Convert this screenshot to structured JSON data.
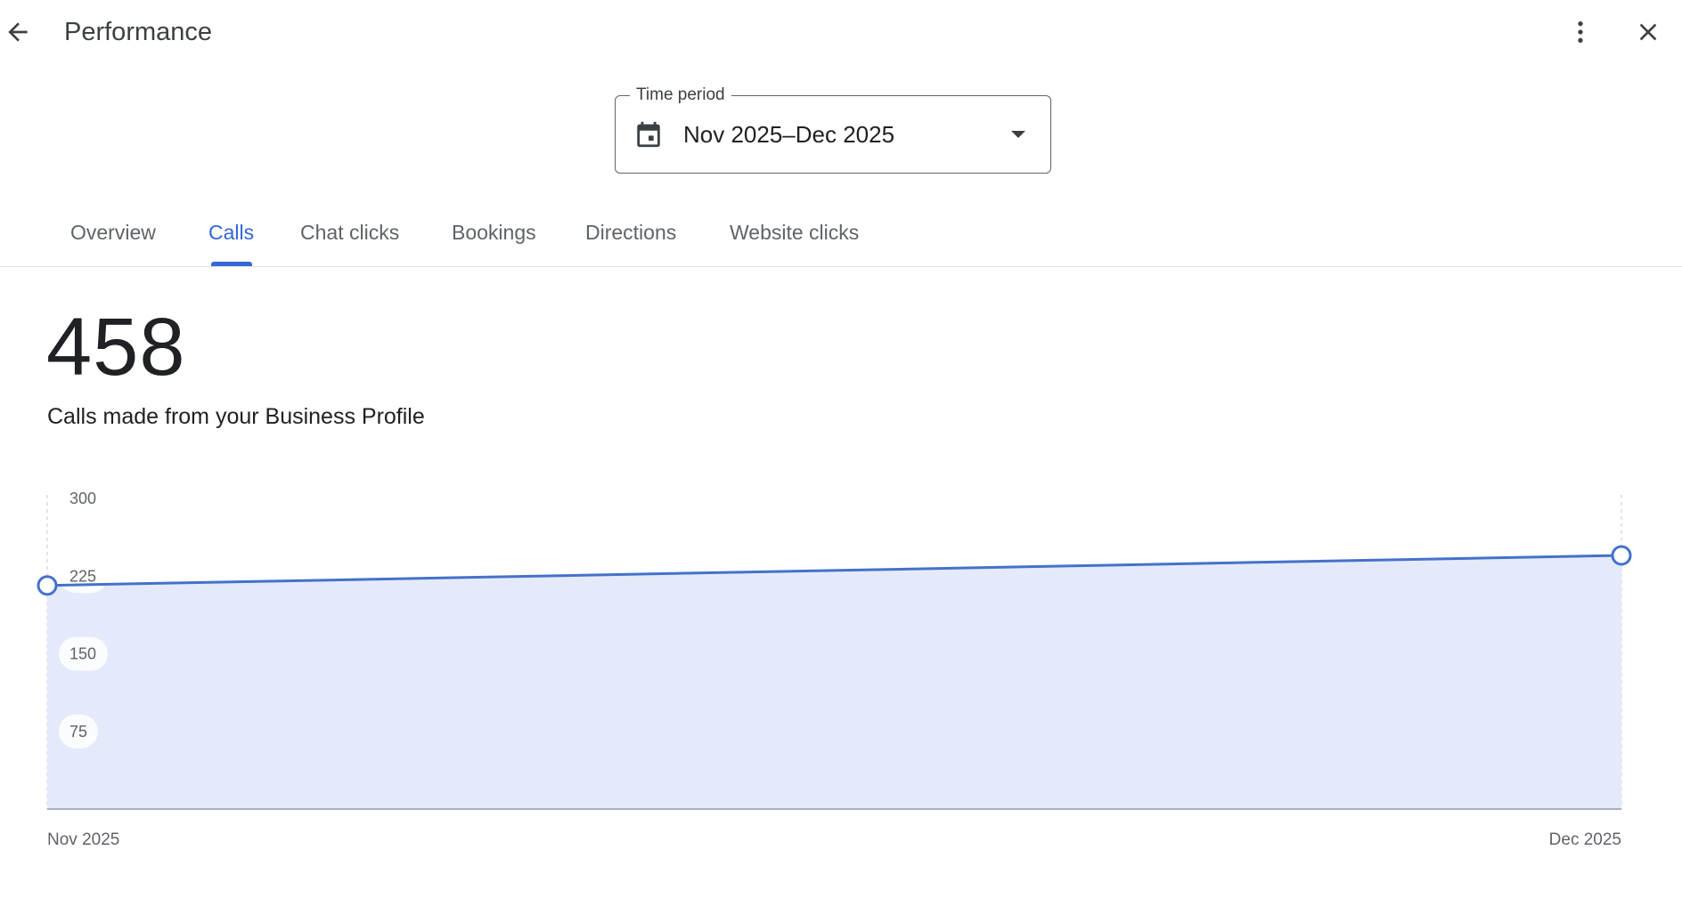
{
  "header": {
    "title": "Performance",
    "back_icon": "arrow-back-icon",
    "more_icon": "more-vert-icon",
    "close_icon": "close-icon"
  },
  "time_period": {
    "label": "Time period",
    "value": "Nov 2025–Dec 2025",
    "calendar_icon": "calendar-icon",
    "dropdown_icon": "arrow-drop-down-icon"
  },
  "tabs": [
    {
      "label": "Overview",
      "active": false
    },
    {
      "label": "Calls",
      "active": true
    },
    {
      "label": "Chat clicks",
      "active": false
    },
    {
      "label": "Bookings",
      "active": false
    },
    {
      "label": "Directions",
      "active": false
    },
    {
      "label": "Website clicks",
      "active": false
    }
  ],
  "metric": {
    "value": "458",
    "description": "Calls made from your Business Profile"
  },
  "colors": {
    "accent": "#3367d6",
    "line": "#4472ca",
    "area_fill": "#e5eafa",
    "text_primary": "#202124",
    "text_secondary": "#5f6368"
  },
  "chart_data": {
    "type": "area",
    "x": [
      "Nov 2025",
      "Dec 2025"
    ],
    "series": [
      {
        "values": [
          216,
          245
        ]
      }
    ],
    "yticks": [
      75,
      150,
      225,
      300
    ],
    "ylim": [
      0,
      300
    ],
    "grid": false,
    "title": "",
    "xlabel": "",
    "ylabel": ""
  }
}
